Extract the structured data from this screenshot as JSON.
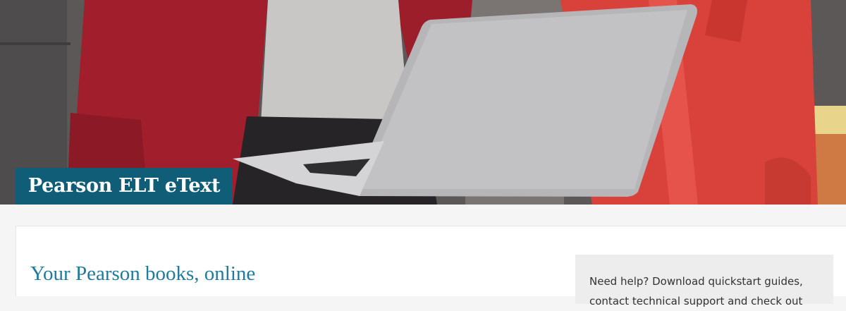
{
  "hero": {
    "title": "Pearson ELT eText"
  },
  "main": {
    "heading": "Your Pearson books, online",
    "help_text": "Need help? Download quickstart guides, contact technical support and check out"
  }
}
